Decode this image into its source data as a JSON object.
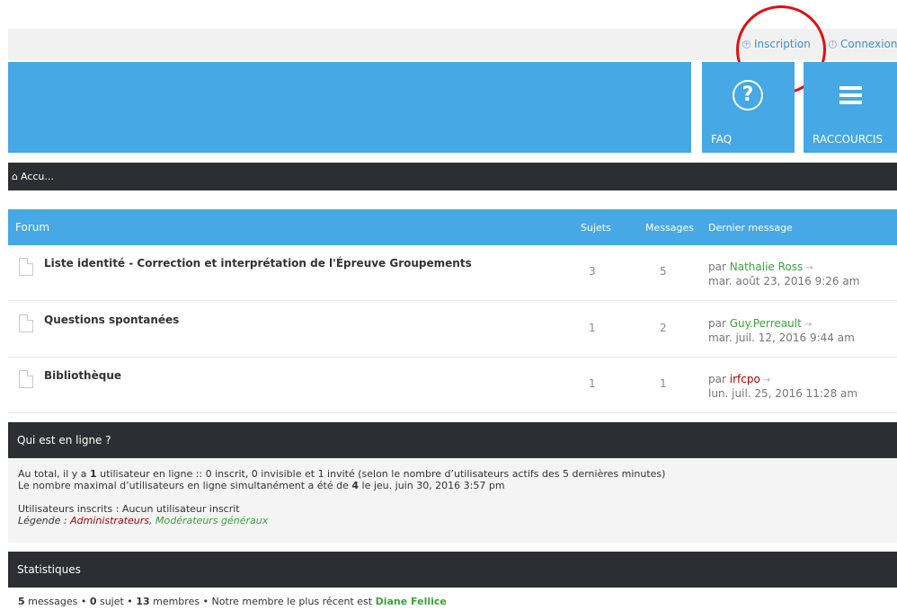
{
  "header": {
    "register_label": "Inscription",
    "login_label": "Connexion",
    "faq_label": "FAQ",
    "shortcuts_label": "RACCOURCIS"
  },
  "breadcrumb": {
    "home_label": "Accu..."
  },
  "forum_table": {
    "columns": {
      "forum": "Forum",
      "topics": "Sujets",
      "posts": "Messages",
      "last_post": "Dernier message"
    },
    "rows": [
      {
        "title": "Liste identité - Correction et interprétation de l'Épreuve Groupements",
        "topics": "3",
        "posts": "5",
        "by": "par",
        "author": "Nathalie Ross",
        "date": "mar. août 23, 2016 9:26 am"
      },
      {
        "title": "Questions spontanées",
        "topics": "1",
        "posts": "2",
        "by": "par",
        "author": "Guy.Perreault",
        "date": "mar. juil. 12, 2016 9:44 am"
      },
      {
        "title": "Bibliothèque",
        "topics": "1",
        "posts": "1",
        "by": "par",
        "author": "irfcpo",
        "date": "lun. juil. 25, 2016 11:28 am"
      }
    ]
  },
  "online": {
    "heading": "Qui est en ligne ?",
    "line1_a": "Au total, il y a ",
    "line1_count": "1",
    "line1_b": " utilisateur en ligne :: 0 inscrit, 0 invisible et 1 invité (selon le nombre d’utilisateurs actifs des 5 dernières minutes)",
    "line2_a": "Le nombre maximal d’utilisateurs en ligne simultanément a été de ",
    "line2_count": "4",
    "line2_b": " le jeu. juin 30, 2016 3:57 pm",
    "registered": "Utilisateurs inscrits : Aucun utilisateur inscrit",
    "legend_label": "Légende : ",
    "legend_admins": "Administrateurs",
    "legend_sep": ", ",
    "legend_mods": "Modérateurs généraux"
  },
  "stats": {
    "heading": "Statistiques",
    "posts_count": "5",
    "posts_label": " messages • ",
    "topics_count": "0",
    "topics_label": " sujet • ",
    "members_count": "13",
    "members_label": " membres • Notre membre le plus récent est ",
    "newest_member": "Diane Fellice"
  },
  "icons": {
    "register": "plus-circle-icon",
    "login": "power-icon",
    "faq": "question-circle-icon",
    "shortcuts": "menu-bars-icon",
    "home": "home-icon",
    "forum": "document-icon",
    "last_post": "arrow-right-icon"
  },
  "colors": {
    "accent": "#46a8e4",
    "dark_bar": "#2b2f33",
    "link_green": "#3aa33a",
    "admin_red": "#aa0000",
    "annotation_red": "#e01010"
  }
}
